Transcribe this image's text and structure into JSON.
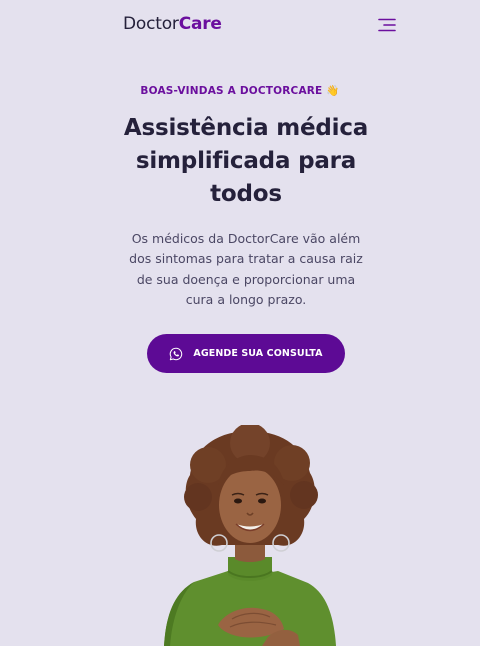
{
  "header": {
    "logo_part1": "Doctor",
    "logo_part2": "Care",
    "menu_icon": "hamburger-menu-icon"
  },
  "hero": {
    "kicker": "BOAS-VINDAS A DOCTORCARE",
    "kicker_emoji": "👋",
    "title": "Assistência médica simplificada para todos",
    "description": "Os médicos da DoctorCare vão além dos sintomas para tratar a causa raiz de sua doença e proporcionar uma cura a longo prazo.",
    "cta_label": "AGENDE SUA CONSULTA",
    "cta_icon": "whatsapp-icon",
    "image_alt": "woman-smiling-photo"
  },
  "colors": {
    "background": "#e4e1ee",
    "brand": "#6b0f9e",
    "button": "#5d0a95",
    "text": "#25213b"
  }
}
